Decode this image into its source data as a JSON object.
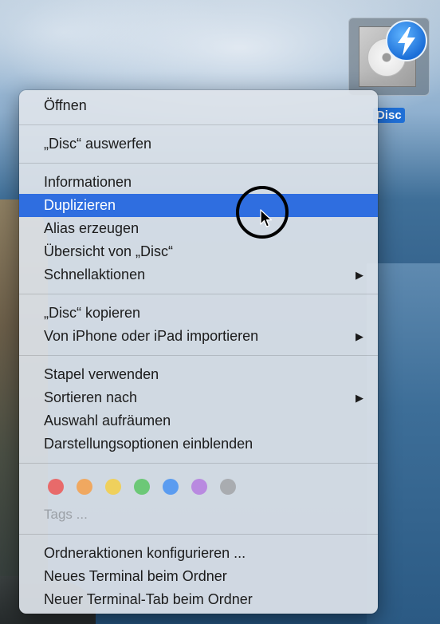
{
  "desktop": {
    "icon_label": "Disc",
    "icon_name": "disc-image-icon",
    "badge_icon_name": "lightning-badge-icon",
    "accent_color": "#2f6ee0"
  },
  "menu": {
    "groups": [
      {
        "items": [
          {
            "label": "Öffnen"
          }
        ]
      },
      {
        "items": [
          {
            "label": "„Disc“ auswerfen"
          }
        ]
      },
      {
        "items": [
          {
            "label": "Informationen"
          },
          {
            "label": "Duplizieren",
            "highlighted": true
          },
          {
            "label": "Alias erzeugen"
          },
          {
            "label": "Übersicht von „Disc“"
          },
          {
            "label": "Schnellaktionen",
            "submenu": true
          }
        ]
      },
      {
        "items": [
          {
            "label": "„Disc“ kopieren"
          },
          {
            "label": "Von iPhone oder iPad importieren",
            "submenu": true
          }
        ]
      },
      {
        "items": [
          {
            "label": "Stapel verwenden"
          },
          {
            "label": "Sortieren nach",
            "submenu": true
          },
          {
            "label": "Auswahl aufräumen"
          },
          {
            "label": "Darstellungsoptionen einblenden"
          }
        ]
      },
      {
        "items": [
          {
            "label": "Ordneraktionen konfigurieren ..."
          },
          {
            "label": "Neues Terminal beim Ordner"
          },
          {
            "label": "Neuer Terminal-Tab beim Ordner"
          }
        ]
      }
    ],
    "tag_colors": [
      "#e86a6a",
      "#f0a860",
      "#efd05c",
      "#6cc877",
      "#5b9cf0",
      "#b98ae0",
      "#a9acb0"
    ],
    "tags_label": "Tags ...",
    "submenu_arrow": "▶"
  }
}
